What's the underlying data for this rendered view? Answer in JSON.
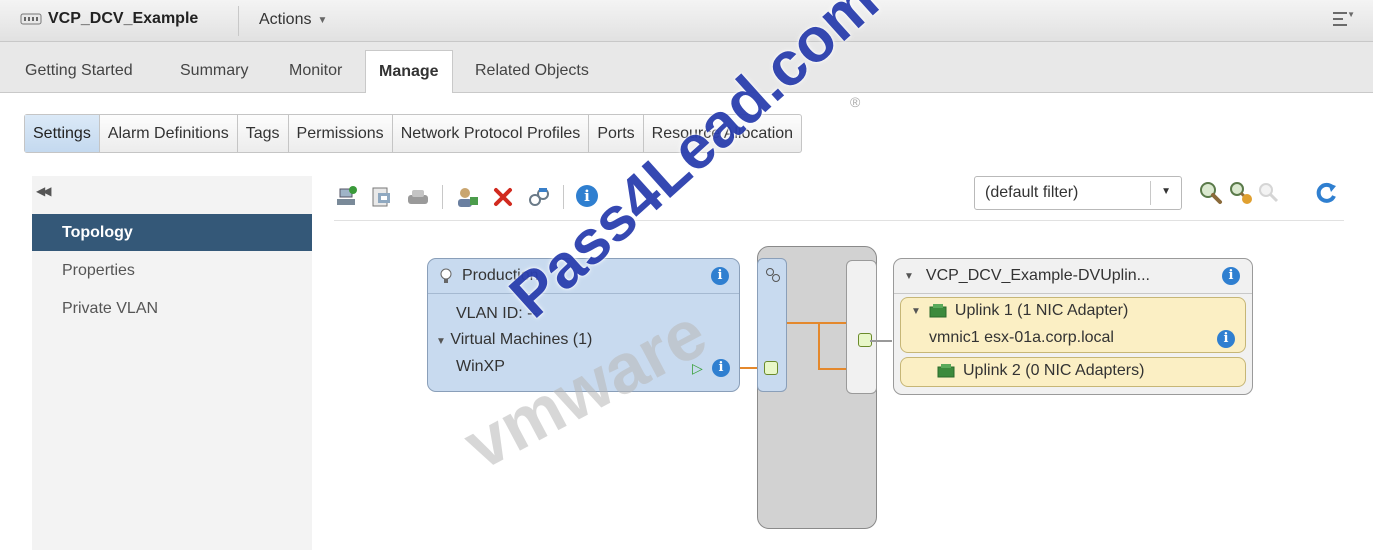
{
  "titlebar": {
    "object_name": "VCP_DCV_Example",
    "actions_label": "Actions"
  },
  "main_tabs": [
    {
      "label": "Getting Started"
    },
    {
      "label": "Summary"
    },
    {
      "label": "Monitor"
    },
    {
      "label": "Manage",
      "active": true
    },
    {
      "label": "Related Objects"
    }
  ],
  "sub_tabs": [
    {
      "label": "Settings",
      "active": true
    },
    {
      "label": "Alarm Definitions"
    },
    {
      "label": "Tags"
    },
    {
      "label": "Permissions"
    },
    {
      "label": "Network Protocol Profiles"
    },
    {
      "label": "Ports"
    },
    {
      "label": "Resource Allocation"
    }
  ],
  "leftnav": {
    "items": [
      {
        "label": "Topology",
        "active": true
      },
      {
        "label": "Properties"
      },
      {
        "label": "Private VLAN"
      }
    ]
  },
  "filter": {
    "value": "(default filter)"
  },
  "topology": {
    "portgroup": {
      "name": "Production",
      "vlan": "VLAN ID: --",
      "vms_label": "Virtual Machines (1)",
      "vm_name": "WinXP"
    },
    "uplinks": {
      "name": "VCP_DCV_Example-DVUplin...",
      "uplink1": "Uplink 1 (1 NIC Adapter)",
      "uplink1_nic": "vmnic1 esx-01a.corp.local",
      "uplink2": "Uplink 2 (0 NIC Adapters)"
    }
  },
  "watermark": {
    "text": "Pass4Lead.com",
    "shadow": "vmware"
  },
  "colors": {
    "nav_active": "#345878",
    "portgroup_fill": "#c8daef",
    "uplink_fill": "#fbefc4",
    "wire": "#e4882c",
    "info": "#2f7fd0",
    "watermark": "#2b3fae"
  }
}
